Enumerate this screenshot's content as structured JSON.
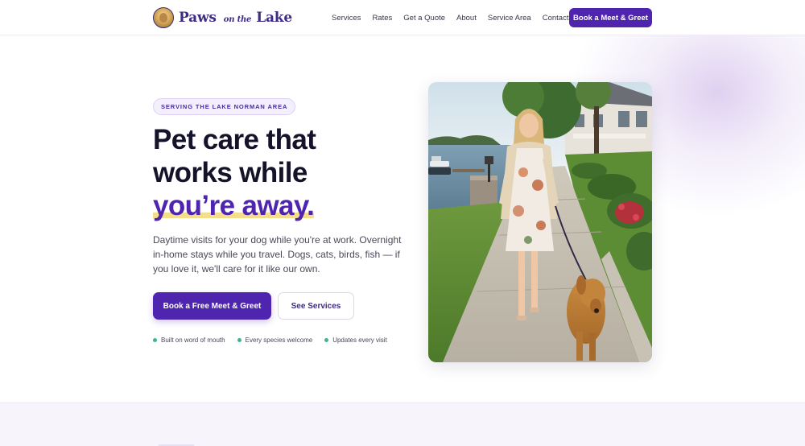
{
  "brand": {
    "part1": "Paws",
    "part2": "on the",
    "part3": "Lake",
    "logo_icon": "dog-portrait-icon"
  },
  "nav": {
    "items": [
      "Services",
      "Rates",
      "Get a Quote",
      "About",
      "Service Area",
      "Contact"
    ],
    "cta": "Book a Meet & Greet"
  },
  "hero": {
    "badge": "SERVING THE LAKE NORMAN AREA",
    "headline_line1": "Pet care that",
    "headline_line2": "works while",
    "headline_accent": "you’re away.",
    "lead": "Daytime visits for your dog while you're at work. Overnight in-home stays while you travel. Dogs, cats, birds, fish — if you love it, we'll care for it like our own.",
    "primary_button": "Book a Free Meet & Greet",
    "secondary_button": "See Services",
    "trust": [
      "Built on word of mouth",
      "Every species welcome",
      "Updates every visit"
    ]
  },
  "colors": {
    "accent": "#4f25b0",
    "highlight": "#f4de8a",
    "trust_dot": "#3fb48d"
  }
}
